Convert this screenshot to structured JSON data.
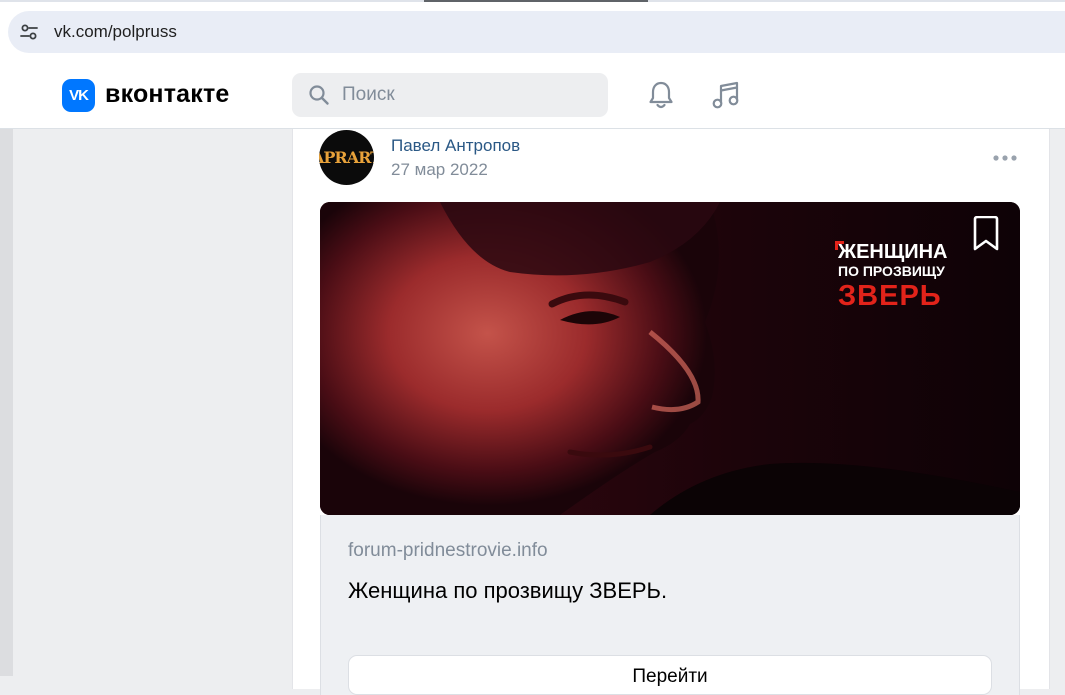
{
  "browser": {
    "url": "vk.com/polpruss",
    "icons": {
      "site_settings": "tune-icon"
    }
  },
  "header": {
    "logo_mark": "VK",
    "wordmark": "вконтакте",
    "search": {
      "placeholder": "Поиск",
      "value": ""
    },
    "icons": {
      "notifications": "bell-icon",
      "music": "music-note-icon"
    }
  },
  "post": {
    "avatar_text": "APRART",
    "author": "Павел Антропов",
    "date": "27 мар 2022",
    "media": {
      "overlay": {
        "line1": "ЖЕНЩИНА",
        "line2": "ПО ПРОЗВИЩУ",
        "line3": "ЗВЕРЬ"
      }
    },
    "link": {
      "domain": "forum-pridnestrovie.info",
      "title": "Женщина по прозвищу ЗВЕРЬ.",
      "button_label": "Перейти"
    }
  },
  "colors": {
    "vk_blue": "#0077ff",
    "author_link": "#2a5885",
    "muted_text": "#818c99",
    "overlay_red": "#e2231a"
  }
}
